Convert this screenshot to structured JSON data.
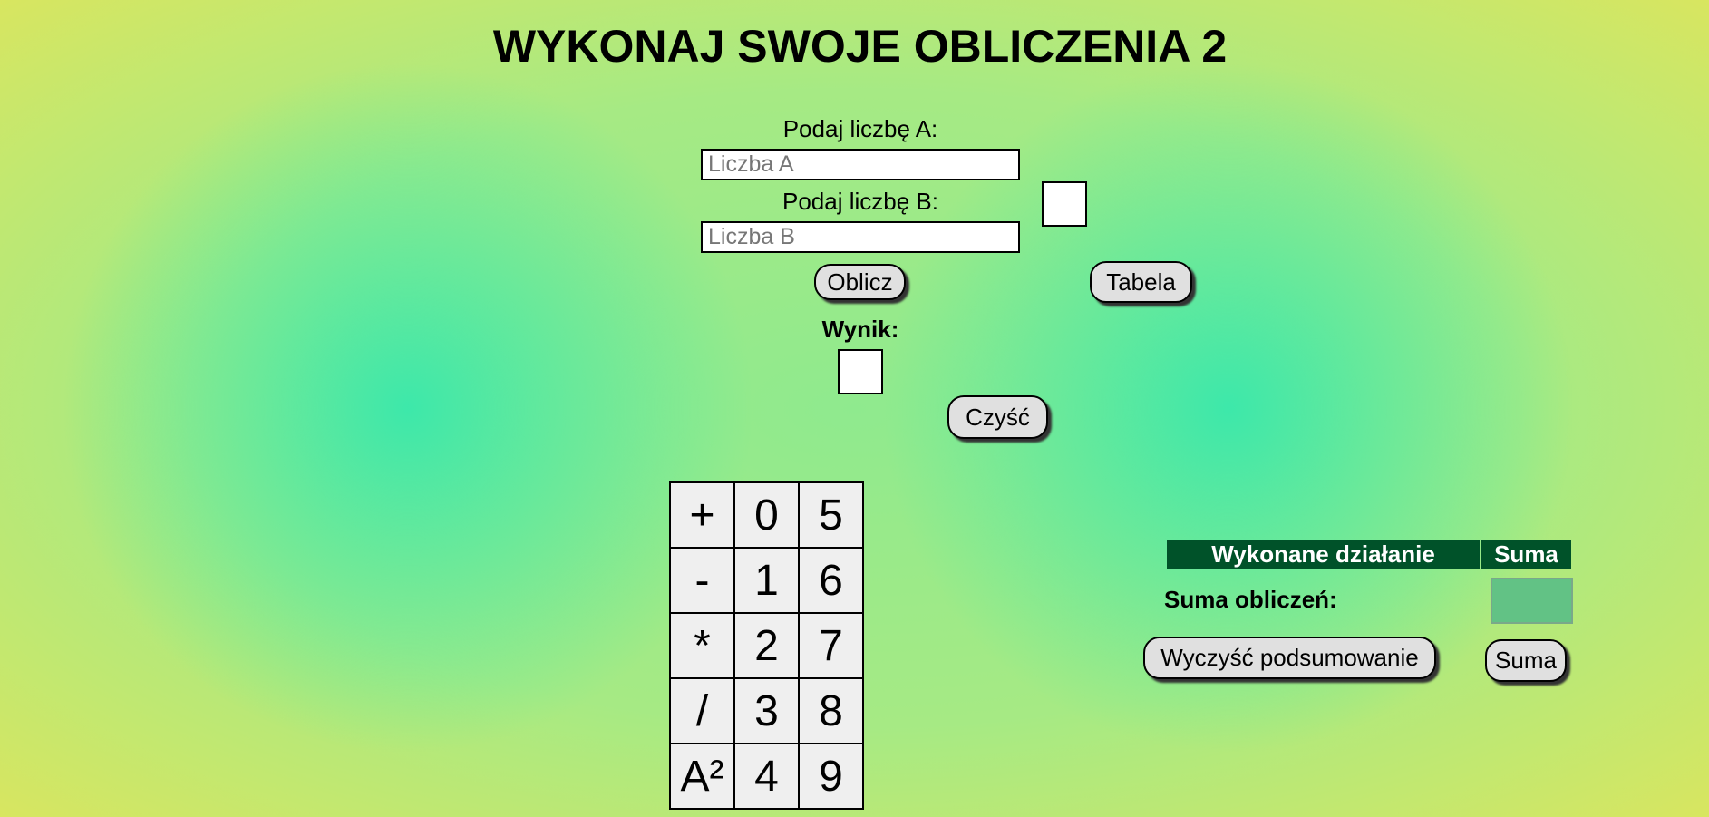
{
  "page": {
    "title": "WYKONAJ SWOJE OBLICZENIA 2"
  },
  "form": {
    "label_a": "Podaj liczbę A:",
    "placeholder_a": "Liczba A",
    "label_b": "Podaj liczbę B:",
    "placeholder_b": "Liczba B",
    "compute_label": "Oblicz",
    "table_label": "Tabela",
    "result_label": "Wynik:",
    "clear_label": "Czyść"
  },
  "keypad": {
    "rows": [
      [
        "+",
        "0",
        "5"
      ],
      [
        "-",
        "1",
        "6"
      ],
      [
        "*",
        "2",
        "7"
      ],
      [
        "/",
        "3",
        "8"
      ],
      [
        "A²",
        "4",
        "9"
      ]
    ]
  },
  "summary": {
    "col_operation": "Wykonane działanie",
    "col_sum": "Suma",
    "sum_label": "Suma obliczeń:",
    "clear_summary_label": "Wyczyść podsumowanie",
    "sum_button_label": "Suma"
  },
  "colors": {
    "table_header_bg": "#005229",
    "sum_box_bg": "#62c285"
  }
}
